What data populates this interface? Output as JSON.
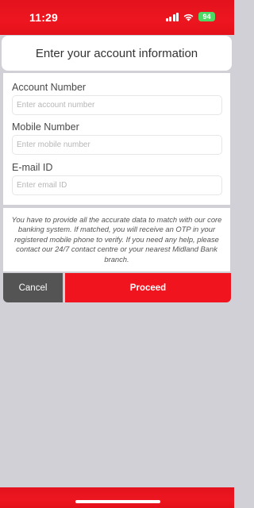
{
  "status_bar": {
    "time": "11:29",
    "battery": "94"
  },
  "header": {
    "title": "Enter your account information"
  },
  "form": {
    "account_number": {
      "label": "Account Number",
      "placeholder": "Enter account number",
      "value": ""
    },
    "mobile_number": {
      "label": "Mobile Number",
      "placeholder": "Enter mobile number",
      "value": ""
    },
    "email": {
      "label": "E-mail ID",
      "placeholder": "Enter email ID",
      "value": ""
    }
  },
  "info": {
    "text": "You have to provide all the accurate data to match with our core banking system. If matched, you will receive an OTP in your registered mobile phone to verify. If you need any help, please contact our 24/7 contact centre or your nearest Midland Bank branch."
  },
  "actions": {
    "cancel_label": "Cancel",
    "proceed_label": "Proceed"
  },
  "colors": {
    "brand_red": "#ed1620",
    "cancel_gray": "#545454",
    "battery_green": "#4cd964",
    "background": "#d1d0d6"
  },
  "icons": [
    "signal-icon",
    "wifi-icon",
    "battery-icon"
  ]
}
